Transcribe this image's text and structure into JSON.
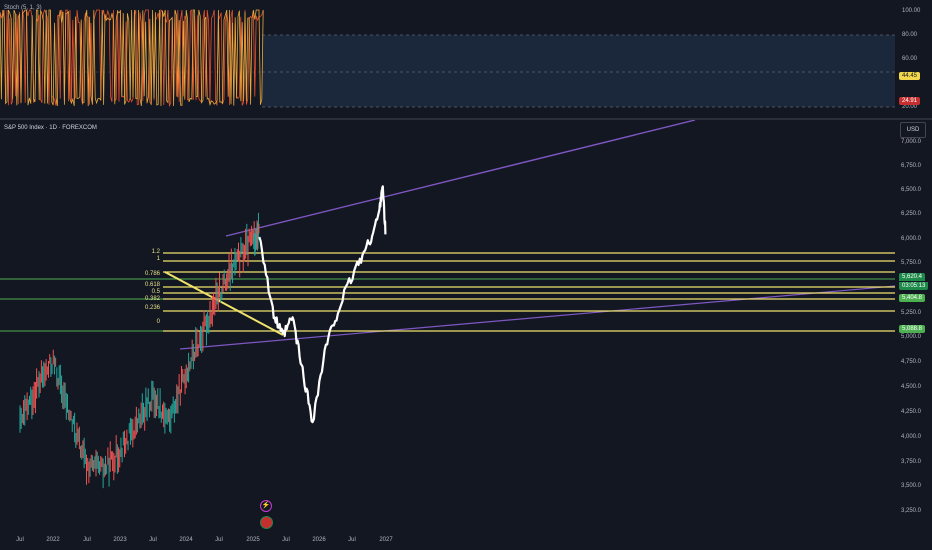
{
  "stoch": {
    "title": "Stoch (5, 1, 3)",
    "scale": [
      "100.00",
      "80.00",
      "60.00",
      "20.00"
    ],
    "badges": {
      "k": "44.45",
      "d": "24.91"
    },
    "colors": {
      "k": "#e6a93c",
      "d": "#e5502d",
      "band": "#1d2b3f"
    }
  },
  "chart": {
    "symbol_title": "S&P 500 Index · 1D · FOREXCOM",
    "currency": "USD",
    "price_ticks": [
      "7,000.0",
      "6,750.0",
      "6,500.0",
      "6,250.0",
      "6,000.0",
      "5,750.0",
      "5,250.0",
      "5,000.0",
      "4,750.0",
      "4,500.0",
      "4,250.0",
      "4,000.0",
      "3,750.0",
      "3,500.0",
      "3,250.0"
    ],
    "price_badges": {
      "last": "5,620.4",
      "countdown": "03:05:13",
      "fib_level": "5,404.8",
      "support": "5,088.8"
    },
    "time_ticks": [
      "Jul",
      "2022",
      "Jul",
      "2023",
      "Jul",
      "2024",
      "Jul",
      "2025",
      "Jul",
      "2026",
      "Jul",
      "2027"
    ],
    "fib_labels": [
      "1.2",
      "1",
      "0.786",
      "0.618",
      "0.5",
      "0.382",
      "0.236",
      "0"
    ],
    "colors": {
      "channel": "#7e57c2",
      "fib": "#f0e36b",
      "green_line": "#4caf50",
      "badge_green": "#1e8a4a",
      "badge_red": "#c62f2f",
      "badge_yellow": "#f2d64b"
    }
  },
  "chart_data": {
    "type": "line",
    "title": "S&P 500 Index · 1D · FOREXCOM",
    "xlabel": "",
    "ylabel": "USD",
    "ylim": [
      3250,
      7000
    ],
    "fib_levels": [
      {
        "ratio": "1.2",
        "price": 5770
      },
      {
        "ratio": "1",
        "price": 5720
      },
      {
        "ratio": "0.786",
        "price": 5640
      },
      {
        "ratio": "0.618",
        "price": 5560
      },
      {
        "ratio": "0.5",
        "price": 5500
      },
      {
        "ratio": "0.382",
        "price": 5440
      },
      {
        "ratio": "0.236",
        "price": 5360
      },
      {
        "ratio": "0",
        "price": 5090
      }
    ],
    "series": [
      {
        "name": "S&P 500 Index",
        "x": [
          "2021-07",
          "2022-01",
          "2022-07",
          "2023-01",
          "2023-07",
          "2024-01",
          "2024-07",
          "2025-01",
          "2025-04",
          "2025-07",
          "2025-10",
          "2026-01",
          "2026-04",
          "2026-07",
          "2026-10",
          "2026-12"
        ],
        "values": [
          4300,
          4800,
          3800,
          3900,
          4500,
          4700,
          5600,
          6100,
          5050,
          4600,
          4200,
          5050,
          5500,
          5900,
          6600,
          6050
        ]
      }
    ],
    "current_price": 5620.4
  }
}
